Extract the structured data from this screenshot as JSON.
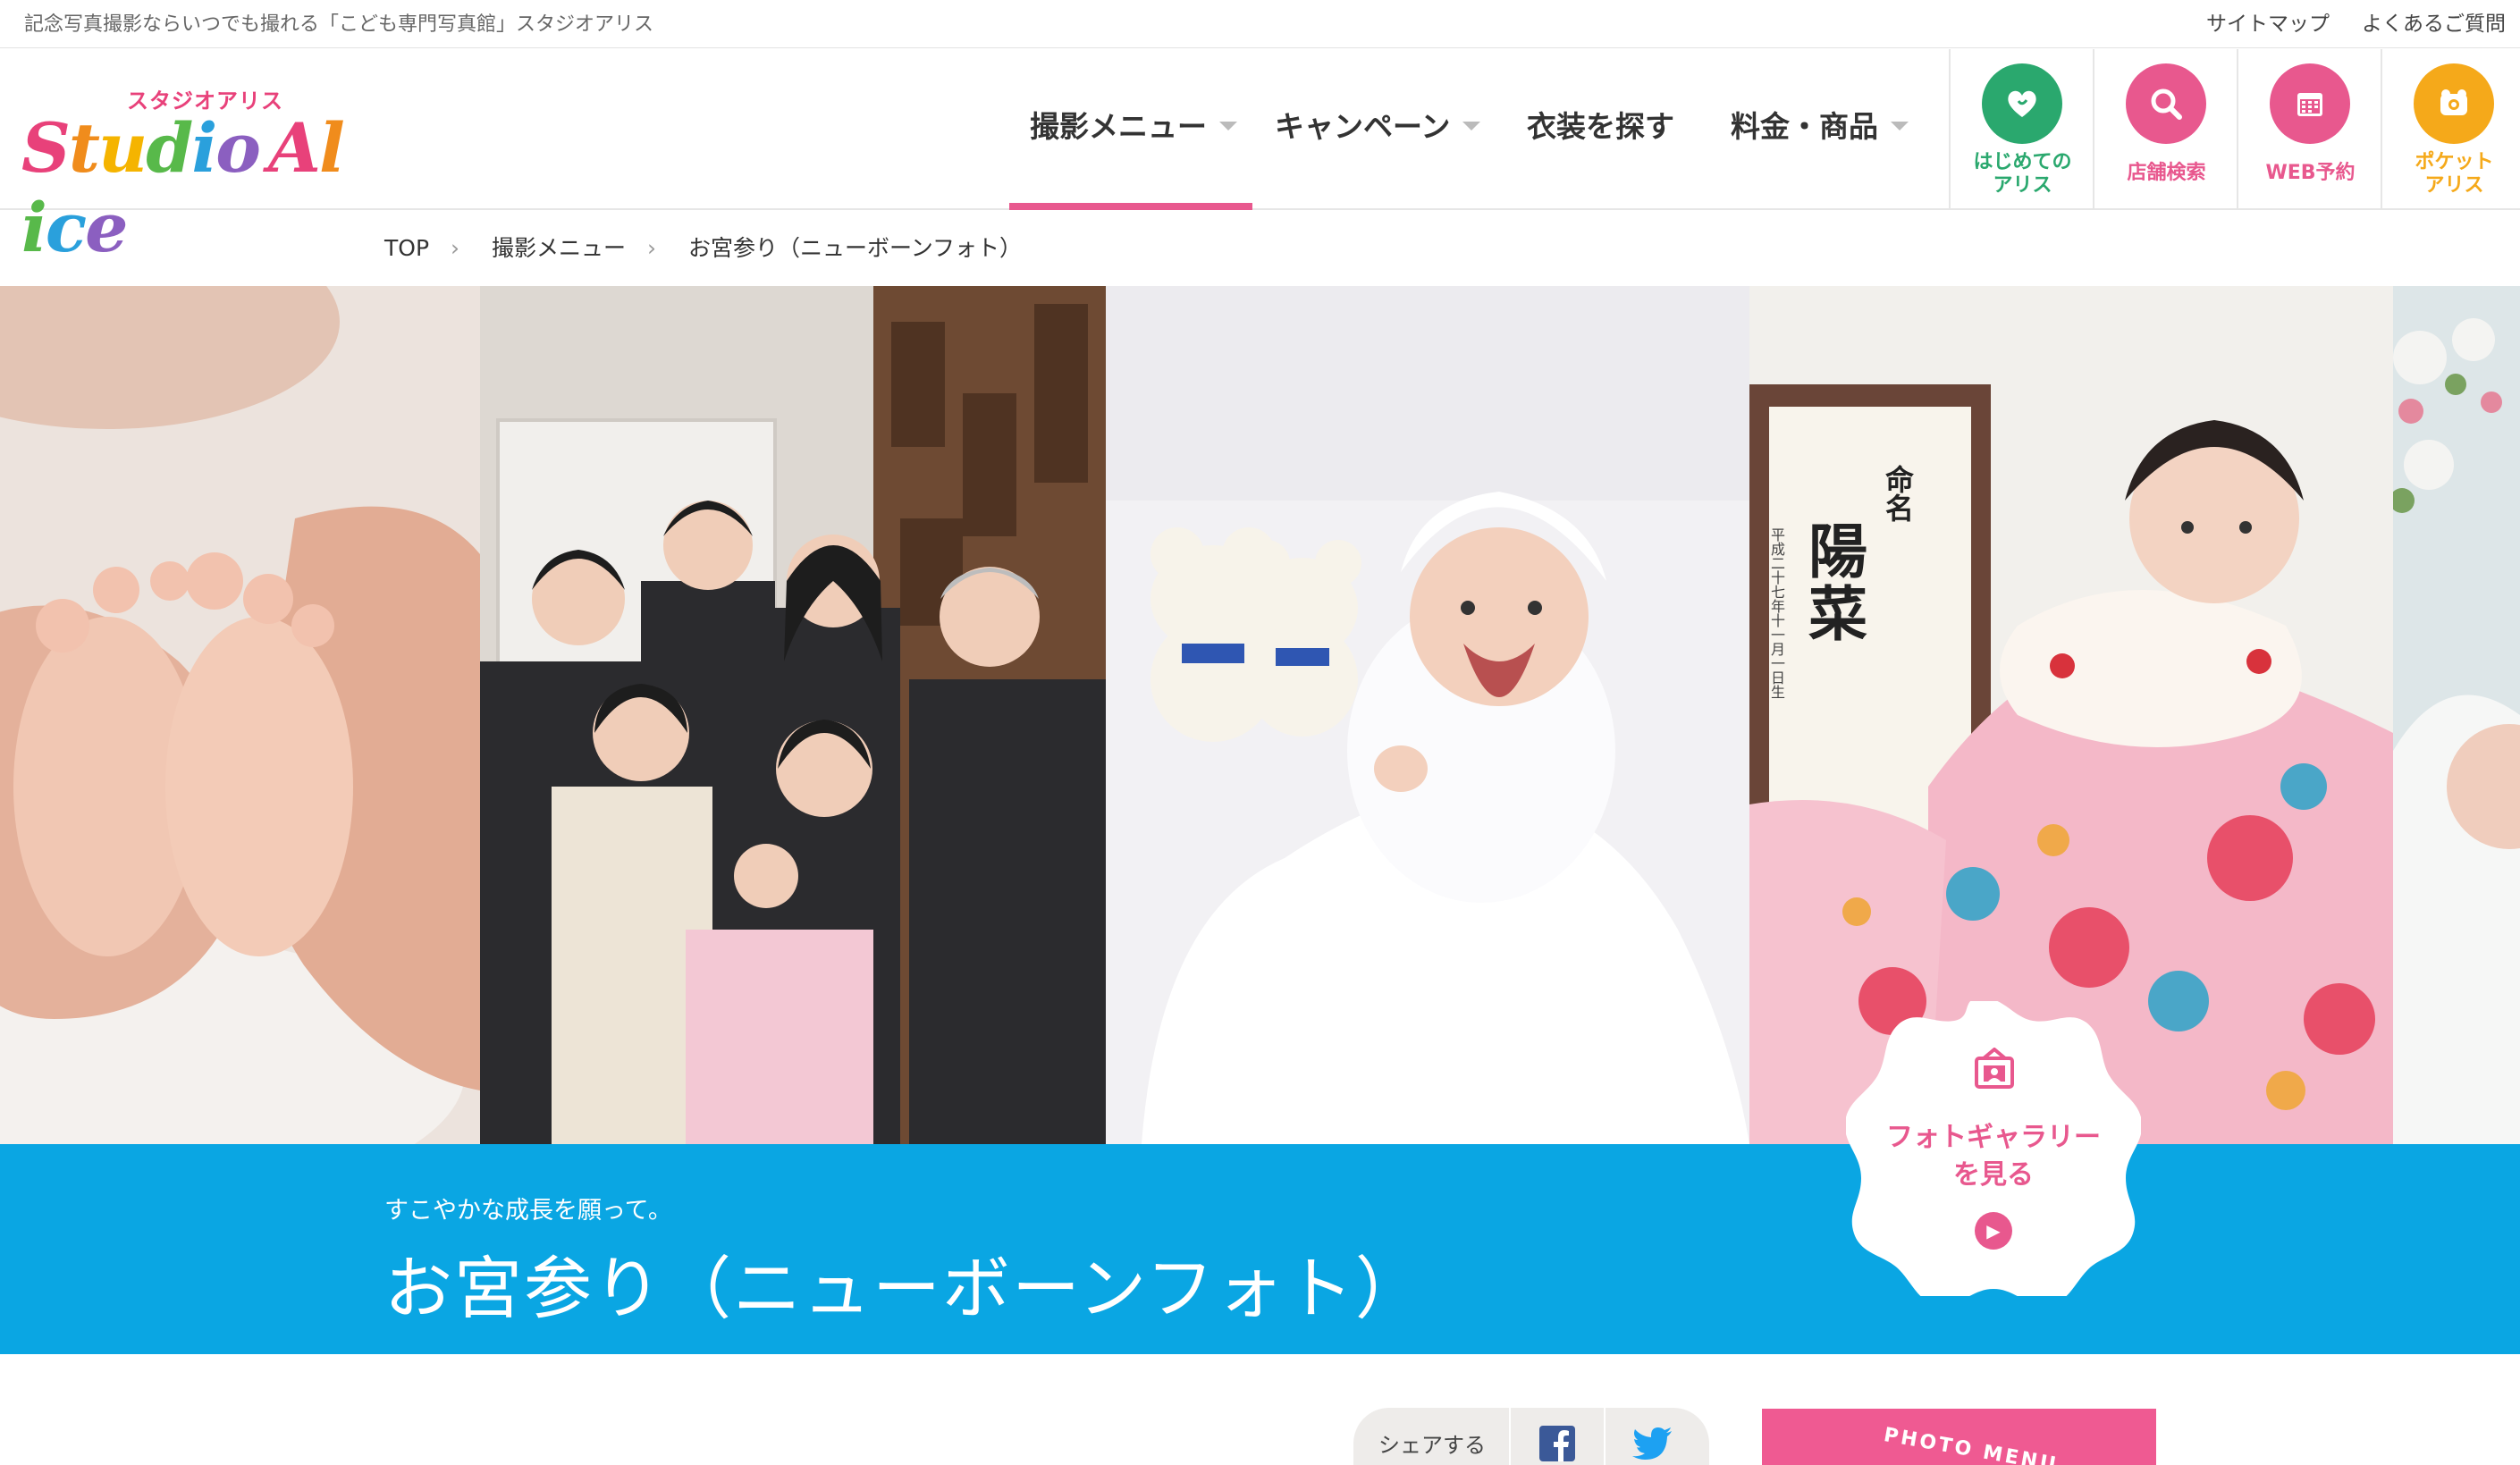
{
  "topbar": {
    "tagline": "記念写真撮影ならいつでも撮れる「こども専門写真館」スタジオアリス",
    "links": [
      "サイトマップ",
      "よくあるご質問"
    ]
  },
  "logo": {
    "kana": "スタジオアリス",
    "word": [
      "S",
      "t",
      "u",
      "d",
      "i",
      "o",
      "A",
      "l",
      "i",
      "c",
      "e"
    ]
  },
  "nav": {
    "items": [
      {
        "label": "撮影メニュー",
        "caret": true
      },
      {
        "label": "キャンペーン",
        "caret": true
      },
      {
        "label": "衣装を探す",
        "caret": false
      },
      {
        "label": "料金・商品",
        "caret": true
      }
    ],
    "shortcuts": [
      {
        "line1": "はじめての",
        "line2": "アリス",
        "color": "#2aa86e",
        "icon": "heart-icon"
      },
      {
        "line1": "店舗検索",
        "line2": "",
        "color": "#e8588e",
        "icon": "search-icon"
      },
      {
        "line1": "WEB予約",
        "line2": "",
        "color": "#e8588e",
        "icon": "calendar-icon"
      },
      {
        "line1": "ポケット",
        "line2": "アリス",
        "color": "#f5a91a",
        "icon": "bear-icon"
      }
    ]
  },
  "breadcrumb": [
    "TOP",
    "撮影メニュー",
    "お宮参り（ニューボーンフォト）"
  ],
  "hero": {
    "lead": "すこやかな成長を願って。",
    "title": "お宮参り（ニューボーンフォト）",
    "gallery_line1": "フォトギャラリー",
    "gallery_line2": "を見る",
    "nameplate_label": "命名",
    "nameplate_name": "陽菜",
    "nameplate_date": "平成二十七年十一月一日生"
  },
  "share": {
    "label": "シェアする"
  },
  "photomenu": {
    "label": "PHOTO MENU"
  }
}
